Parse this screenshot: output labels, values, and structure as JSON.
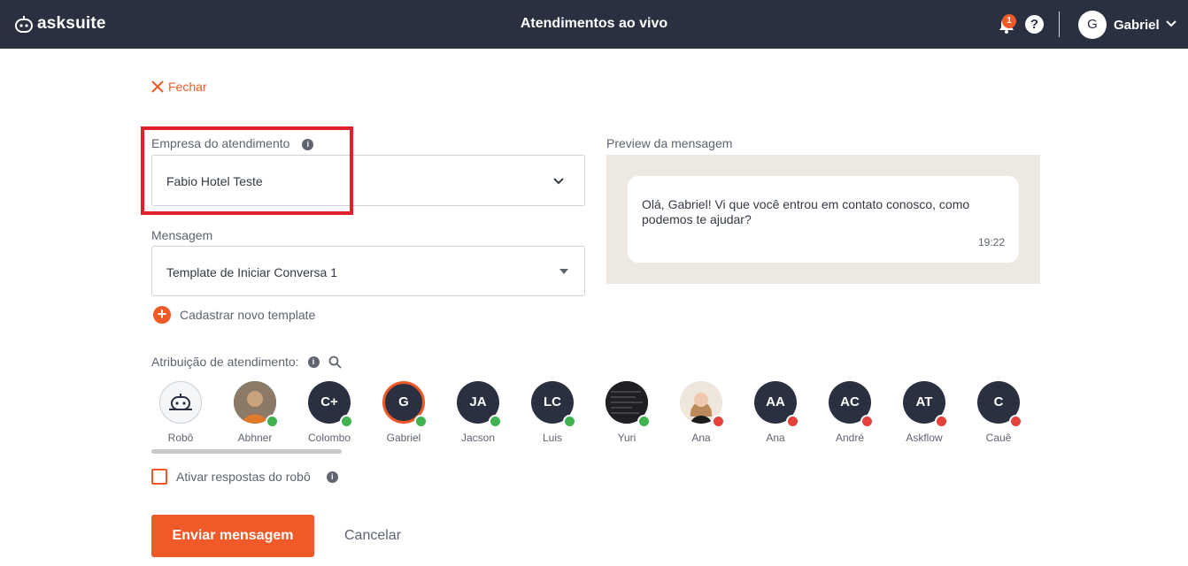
{
  "header": {
    "brand": "asksuite",
    "title": "Atendimentos ao vivo",
    "notifications_count": "1",
    "help_label": "?",
    "user_initial": "G",
    "user_name": "Gabriel"
  },
  "close_label": "Fechar",
  "company": {
    "label": "Empresa do atendimento",
    "value": "Fabio Hotel Teste"
  },
  "message": {
    "label": "Mensagem",
    "value": "Template de Iniciar Conversa 1",
    "add_template_label": "Cadastrar novo template"
  },
  "preview": {
    "label": "Preview da mensagem",
    "text": "Olá, Gabriel! Vi que você entrou em contato conosco, como podemos te ajudar?",
    "time": "19:22"
  },
  "assignment": {
    "label": "Atribuição de atendimento:",
    "agents": [
      {
        "name": "Robô",
        "initials": "",
        "status": "none"
      },
      {
        "name": "Abhner",
        "initials": "",
        "status": "online"
      },
      {
        "name": "Colombo",
        "initials": "C+",
        "status": "online"
      },
      {
        "name": "Gabriel",
        "initials": "G",
        "status": "online",
        "selected": true
      },
      {
        "name": "Jacson",
        "initials": "JA",
        "status": "online"
      },
      {
        "name": "Luis",
        "initials": "LC",
        "status": "online"
      },
      {
        "name": "Yuri",
        "initials": "",
        "status": "online"
      },
      {
        "name": "Ana",
        "initials": "",
        "status": "offline"
      },
      {
        "name": "Ana",
        "initials": "AA",
        "status": "offline"
      },
      {
        "name": "André",
        "initials": "AC",
        "status": "offline"
      },
      {
        "name": "Askflow",
        "initials": "AT",
        "status": "offline"
      },
      {
        "name": "Cauê",
        "initials": "C",
        "status": "offline"
      }
    ]
  },
  "bot_toggle_label": "Ativar respostas do robô",
  "buttons": {
    "send": "Enviar mensagem",
    "cancel": "Cancelar"
  },
  "colors": {
    "header_bg": "#2b3041",
    "accent": "#f05a28",
    "online": "#3fb34f",
    "offline": "#e5403a",
    "highlight": "#e0202a"
  }
}
